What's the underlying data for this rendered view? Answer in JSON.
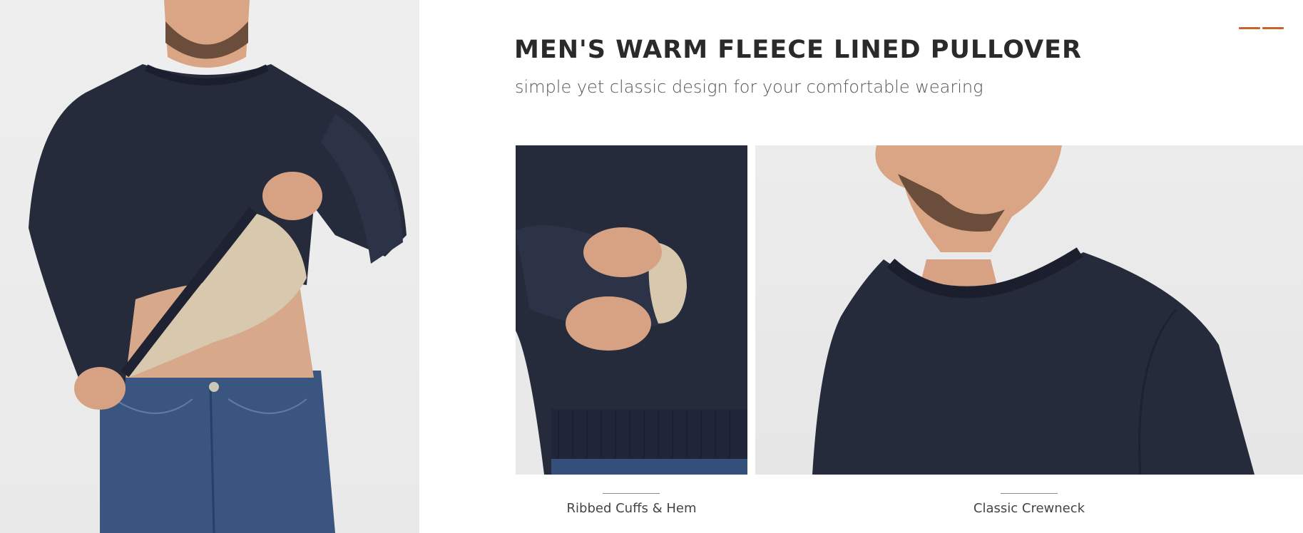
{
  "header": {
    "title": "MEN'S WARM FLEECE LINED PULLOVER",
    "subtitle": "simple yet classic design for your comfortable wearing"
  },
  "features": [
    {
      "caption": "Ribbed Cuffs & Hem"
    },
    {
      "caption": "Classic Crewneck"
    }
  ],
  "colors": {
    "accent": "#c8632a",
    "sweater": "#262b3c",
    "fleece": "#d8c8ad",
    "denim": "#34507a",
    "background": "#ffffff",
    "photo_backdrop": "#ebebeb"
  }
}
